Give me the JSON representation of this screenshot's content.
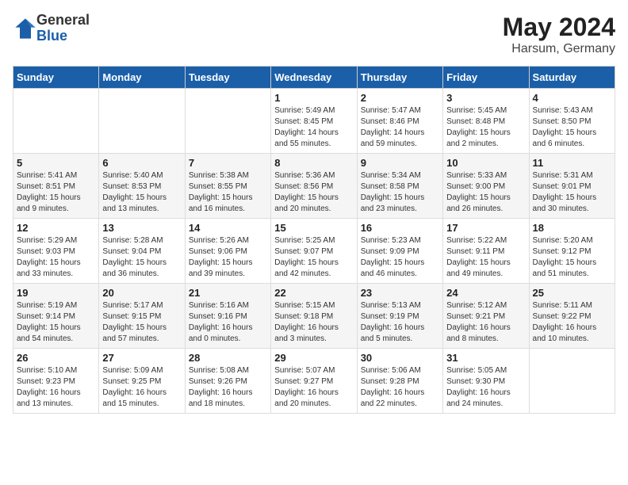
{
  "header": {
    "logo_general": "General",
    "logo_blue": "Blue",
    "month": "May 2024",
    "location": "Harsum, Germany"
  },
  "days_of_week": [
    "Sunday",
    "Monday",
    "Tuesday",
    "Wednesday",
    "Thursday",
    "Friday",
    "Saturday"
  ],
  "weeks": [
    [
      {
        "day": "",
        "info": ""
      },
      {
        "day": "",
        "info": ""
      },
      {
        "day": "",
        "info": ""
      },
      {
        "day": "1",
        "info": "Sunrise: 5:49 AM\nSunset: 8:45 PM\nDaylight: 14 hours\nand 55 minutes."
      },
      {
        "day": "2",
        "info": "Sunrise: 5:47 AM\nSunset: 8:46 PM\nDaylight: 14 hours\nand 59 minutes."
      },
      {
        "day": "3",
        "info": "Sunrise: 5:45 AM\nSunset: 8:48 PM\nDaylight: 15 hours\nand 2 minutes."
      },
      {
        "day": "4",
        "info": "Sunrise: 5:43 AM\nSunset: 8:50 PM\nDaylight: 15 hours\nand 6 minutes."
      }
    ],
    [
      {
        "day": "5",
        "info": "Sunrise: 5:41 AM\nSunset: 8:51 PM\nDaylight: 15 hours\nand 9 minutes."
      },
      {
        "day": "6",
        "info": "Sunrise: 5:40 AM\nSunset: 8:53 PM\nDaylight: 15 hours\nand 13 minutes."
      },
      {
        "day": "7",
        "info": "Sunrise: 5:38 AM\nSunset: 8:55 PM\nDaylight: 15 hours\nand 16 minutes."
      },
      {
        "day": "8",
        "info": "Sunrise: 5:36 AM\nSunset: 8:56 PM\nDaylight: 15 hours\nand 20 minutes."
      },
      {
        "day": "9",
        "info": "Sunrise: 5:34 AM\nSunset: 8:58 PM\nDaylight: 15 hours\nand 23 minutes."
      },
      {
        "day": "10",
        "info": "Sunrise: 5:33 AM\nSunset: 9:00 PM\nDaylight: 15 hours\nand 26 minutes."
      },
      {
        "day": "11",
        "info": "Sunrise: 5:31 AM\nSunset: 9:01 PM\nDaylight: 15 hours\nand 30 minutes."
      }
    ],
    [
      {
        "day": "12",
        "info": "Sunrise: 5:29 AM\nSunset: 9:03 PM\nDaylight: 15 hours\nand 33 minutes."
      },
      {
        "day": "13",
        "info": "Sunrise: 5:28 AM\nSunset: 9:04 PM\nDaylight: 15 hours\nand 36 minutes."
      },
      {
        "day": "14",
        "info": "Sunrise: 5:26 AM\nSunset: 9:06 PM\nDaylight: 15 hours\nand 39 minutes."
      },
      {
        "day": "15",
        "info": "Sunrise: 5:25 AM\nSunset: 9:07 PM\nDaylight: 15 hours\nand 42 minutes."
      },
      {
        "day": "16",
        "info": "Sunrise: 5:23 AM\nSunset: 9:09 PM\nDaylight: 15 hours\nand 46 minutes."
      },
      {
        "day": "17",
        "info": "Sunrise: 5:22 AM\nSunset: 9:11 PM\nDaylight: 15 hours\nand 49 minutes."
      },
      {
        "day": "18",
        "info": "Sunrise: 5:20 AM\nSunset: 9:12 PM\nDaylight: 15 hours\nand 51 minutes."
      }
    ],
    [
      {
        "day": "19",
        "info": "Sunrise: 5:19 AM\nSunset: 9:14 PM\nDaylight: 15 hours\nand 54 minutes."
      },
      {
        "day": "20",
        "info": "Sunrise: 5:17 AM\nSunset: 9:15 PM\nDaylight: 15 hours\nand 57 minutes."
      },
      {
        "day": "21",
        "info": "Sunrise: 5:16 AM\nSunset: 9:16 PM\nDaylight: 16 hours\nand 0 minutes."
      },
      {
        "day": "22",
        "info": "Sunrise: 5:15 AM\nSunset: 9:18 PM\nDaylight: 16 hours\nand 3 minutes."
      },
      {
        "day": "23",
        "info": "Sunrise: 5:13 AM\nSunset: 9:19 PM\nDaylight: 16 hours\nand 5 minutes."
      },
      {
        "day": "24",
        "info": "Sunrise: 5:12 AM\nSunset: 9:21 PM\nDaylight: 16 hours\nand 8 minutes."
      },
      {
        "day": "25",
        "info": "Sunrise: 5:11 AM\nSunset: 9:22 PM\nDaylight: 16 hours\nand 10 minutes."
      }
    ],
    [
      {
        "day": "26",
        "info": "Sunrise: 5:10 AM\nSunset: 9:23 PM\nDaylight: 16 hours\nand 13 minutes."
      },
      {
        "day": "27",
        "info": "Sunrise: 5:09 AM\nSunset: 9:25 PM\nDaylight: 16 hours\nand 15 minutes."
      },
      {
        "day": "28",
        "info": "Sunrise: 5:08 AM\nSunset: 9:26 PM\nDaylight: 16 hours\nand 18 minutes."
      },
      {
        "day": "29",
        "info": "Sunrise: 5:07 AM\nSunset: 9:27 PM\nDaylight: 16 hours\nand 20 minutes."
      },
      {
        "day": "30",
        "info": "Sunrise: 5:06 AM\nSunset: 9:28 PM\nDaylight: 16 hours\nand 22 minutes."
      },
      {
        "day": "31",
        "info": "Sunrise: 5:05 AM\nSunset: 9:30 PM\nDaylight: 16 hours\nand 24 minutes."
      },
      {
        "day": "",
        "info": ""
      }
    ]
  ]
}
